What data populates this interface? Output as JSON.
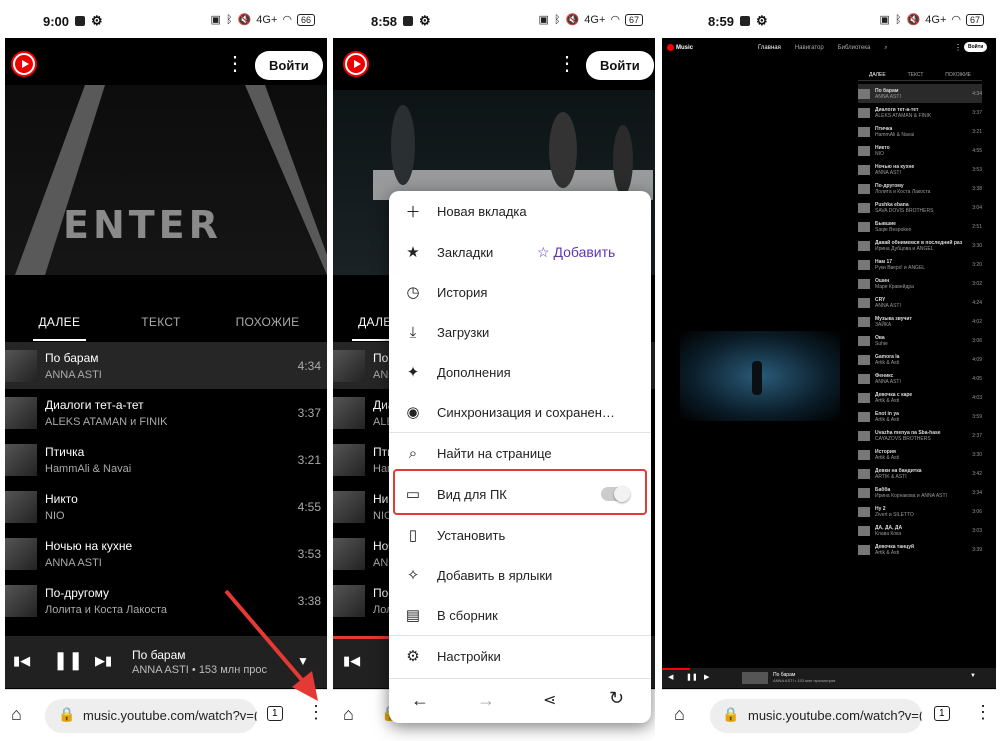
{
  "screens": [
    {
      "time": "9:00",
      "battery": "66"
    },
    {
      "time": "8:58",
      "battery": "67"
    },
    {
      "time": "8:59",
      "battery": "67"
    }
  ],
  "status": {
    "network": "4G+"
  },
  "header": {
    "signin_label": "Войти"
  },
  "tabs": [
    "ДАЛЕЕ",
    "ТЕКСТ",
    "ПОХОЖИЕ"
  ],
  "playlist": [
    {
      "title": "По барам",
      "artist": "ANNA ASTI",
      "duration": "4:34"
    },
    {
      "title": "Диалоги тет-а-тет",
      "artist": "ALEKS ATAMAN и FINIK",
      "duration": "3:37"
    },
    {
      "title": "Птичка",
      "artist": "HammAli & Navai",
      "duration": "3:21"
    },
    {
      "title": "Никто",
      "artist": "NIO",
      "duration": "4:55"
    },
    {
      "title": "Ночью на кухне",
      "artist": "ANNA ASTI",
      "duration": "3:53"
    },
    {
      "title": "По-другому",
      "artist": "Лолита и Коста Лакоста",
      "duration": "3:38"
    }
  ],
  "player": {
    "title": "По барам",
    "subtitle": "ANNA ASTI • 153 млн прос"
  },
  "video_text": "ENTER",
  "browser": {
    "url": "music.youtube.com/watch?v=(",
    "tab_count": "1"
  },
  "menu": {
    "new_tab": "Новая вкладка",
    "bookmarks": "Закладки",
    "add": "Добавить",
    "history": "История",
    "downloads": "Загрузки",
    "extensions": "Дополнения",
    "sync": "Синхронизация и сохранен…",
    "find": "Найти на странице",
    "desktop": "Вид для ПК",
    "install": "Установить",
    "shortcuts": "Добавить в ярлыки",
    "collection": "В сборник",
    "settings": "Настройки"
  },
  "desktop": {
    "logo": "Music",
    "nav": [
      "Главная",
      "Навигатор",
      "Библиотека"
    ],
    "tabs": [
      "ДАЛЕЕ",
      "ТЕКСТ",
      "ПОХОЖИЕ"
    ],
    "rows": [
      {
        "t": "По барам",
        "a": "ANNA ASTI",
        "d": "4:34"
      },
      {
        "t": "Диалоги тет-а-тет",
        "a": "ALEKS ATAMAN & FINIK",
        "d": "3:37"
      },
      {
        "t": "Птичка",
        "a": "HammAli & Navai",
        "d": "3:21"
      },
      {
        "t": "Никто",
        "a": "NIO",
        "d": "4:55"
      },
      {
        "t": "Ночью на кухне",
        "a": "ANNA ASTI",
        "d": "3:53"
      },
      {
        "t": "По-другому",
        "a": "Лолита и Коста Лакоста",
        "d": "3:38"
      },
      {
        "t": "Pushka ebana",
        "a": "SAVA DOVIS BROTHERS",
        "d": "3:04"
      },
      {
        "t": "Бывшие",
        "a": "Saqie Bespoken",
        "d": "2:51"
      },
      {
        "t": "Давай обнимемся в последний раз",
        "a": "Ирина Дубцова и ANGEL",
        "d": "3:30"
      },
      {
        "t": "Нам 17",
        "a": "Руки Вверх! и ANGEL",
        "d": "3:20"
      },
      {
        "t": "Ошин",
        "a": "Маря Кравейдра",
        "d": "3:02"
      },
      {
        "t": "CRY",
        "a": "ANNA ASTI",
        "d": "4:24"
      },
      {
        "t": "Музыка звучит",
        "a": "ЗАЙКА",
        "d": "4:02"
      },
      {
        "t": "Ова",
        "a": "Suhie",
        "d": "3:06"
      },
      {
        "t": "Gamora la",
        "a": "Artik & Asti",
        "d": "4:09"
      },
      {
        "t": "Феникс",
        "a": "ANNA ASTI",
        "d": "4:05"
      },
      {
        "t": "Девочка с каре",
        "a": "Artik & Asti",
        "d": "4:03"
      },
      {
        "t": "Enot in ya",
        "a": "Artik & Asti",
        "d": "3:59"
      },
      {
        "t": "Uvazha menya na Sba-hase",
        "a": "CAYAZOVS BROTHERS",
        "d": "2:37"
      },
      {
        "t": "История",
        "a": "Artik & Asti",
        "d": "3:30"
      },
      {
        "t": "Девки на бандитка",
        "a": "ARTIK & ASTI",
        "d": "3:42"
      },
      {
        "t": "Бабба",
        "a": "Ирина Корнакова и ANNA ASTI",
        "d": "3:34"
      },
      {
        "t": "Ну 2",
        "a": "Zivert и SILETTO",
        "d": "3:06"
      },
      {
        "t": "ДА, ДА, ДА",
        "a": "Клава Кока",
        "d": "3:03"
      },
      {
        "t": "Девочка танцуй",
        "a": "Artik & Asti",
        "d": "3:39"
      }
    ],
    "player_title": "По барам",
    "player_sub": "ANNA ASTI • 153 млн просмотров"
  },
  "colors": {
    "accent": "#e53935",
    "yt_red": "#ff0000",
    "menu_purple": "#5e35b1"
  }
}
